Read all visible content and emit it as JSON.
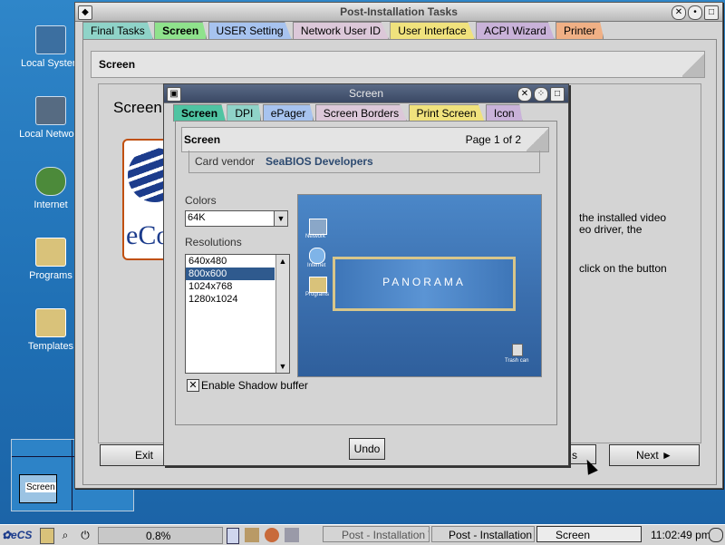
{
  "desktop": {
    "icons": [
      {
        "label": "Local System",
        "icon": "computer-icon",
        "color": "#3c6fa0"
      },
      {
        "label": "Local Network",
        "icon": "network-icon",
        "color": "#566b82"
      },
      {
        "label": "Internet",
        "icon": "globe-icon",
        "color": "#4c8a3a"
      },
      {
        "label": "Programs",
        "icon": "folder-programs-icon",
        "color": "#d9c27a"
      },
      {
        "label": "Templates",
        "icon": "folder-templates-icon",
        "color": "#d9c27a"
      }
    ]
  },
  "main_window": {
    "title": "Post-Installation Tasks",
    "tabs": [
      {
        "label": "Final Tasks",
        "color": "#8fd3c8"
      },
      {
        "label": "Screen",
        "color": "#8fe28c",
        "active": true
      },
      {
        "label": "USER Setting",
        "color": "#a7c3ef"
      },
      {
        "label": "Network User ID",
        "color": "#dcc8d9"
      },
      {
        "label": "User Interface",
        "color": "#f0e27d"
      },
      {
        "label": "ACPI Wizard",
        "color": "#c9b2d9"
      },
      {
        "label": "Printer",
        "color": "#f0b085"
      }
    ],
    "section_title": "Screen",
    "content_heading": "Screen",
    "logo_text": "eCom",
    "body_text": [
      "the installed video",
      "eo driver, the",
      "click on the button"
    ],
    "buttons": {
      "exit": "Exit",
      "prev_partial": "s",
      "next": "Next ►"
    }
  },
  "dialog": {
    "title": "Screen",
    "tabs": [
      {
        "label": "Screen",
        "color": "#4fc4a2",
        "active": true
      },
      {
        "label": "DPI",
        "color": "#8fd3c8"
      },
      {
        "label": "ePager",
        "color": "#a7c3ef"
      },
      {
        "label": "Screen Borders",
        "color": "#dcc8d9"
      },
      {
        "label": "Print Screen",
        "color": "#f0e27d"
      },
      {
        "label": "Icon",
        "color": "#c9b2d9"
      }
    ],
    "header": {
      "title": "Screen",
      "page": "Page 1 of 2"
    },
    "card_vendor_label": "Card vendor",
    "card_vendor_value": "SeaBIOS Developers",
    "colors_label": "Colors",
    "colors_value": "64K",
    "resolutions_label": "Resolutions",
    "resolutions": [
      "640x480",
      "800x600",
      "1024x768",
      "1280x1024"
    ],
    "selected_resolution": "800x600",
    "preview": {
      "banner": "PANORAMA",
      "icons": [
        "Network",
        "Internet",
        "Programs"
      ],
      "trash": "Trash can"
    },
    "shadow_label": "Enable Shadow buffer",
    "shadow_checked": true,
    "undo_label": "Undo"
  },
  "taskbar": {
    "cpu": "0.8%",
    "tasks": [
      "Post - Installation Task",
      "Post - Installation Task",
      "Screen"
    ],
    "clock": "11:02:49 pm",
    "pager_label": "Screen"
  }
}
